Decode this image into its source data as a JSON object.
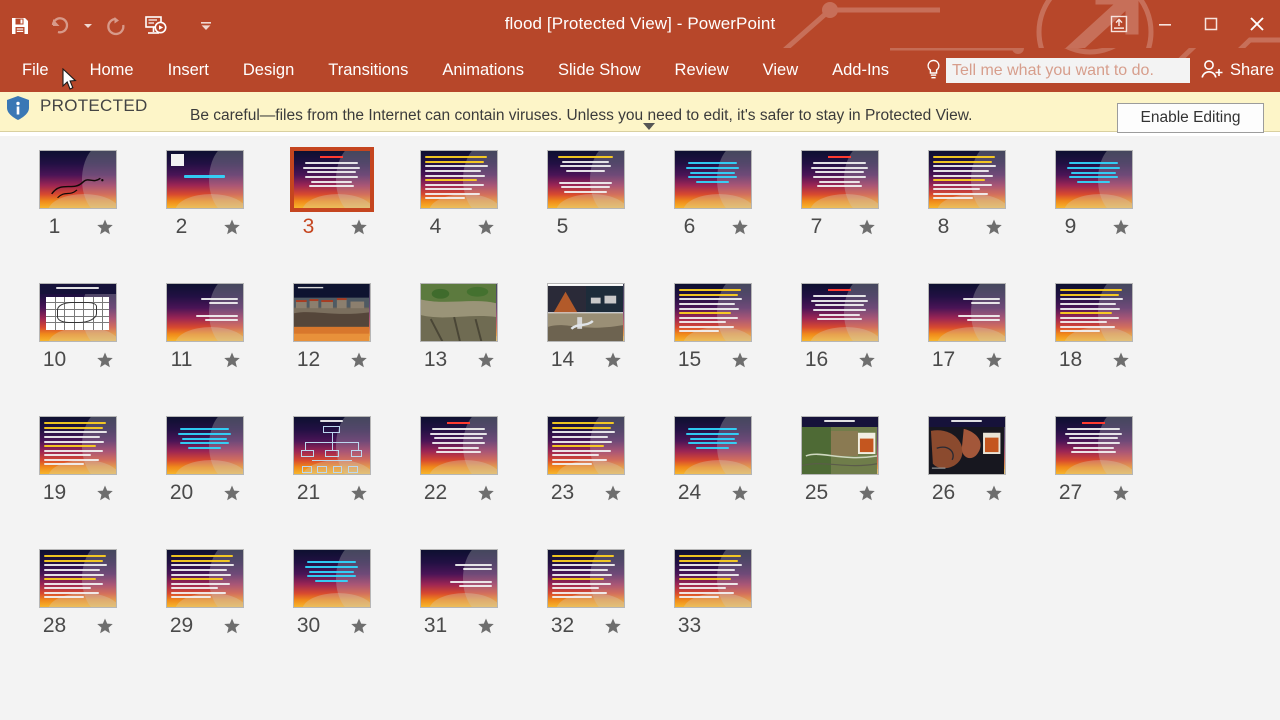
{
  "window": {
    "title": "flood [Protected View] - PowerPoint",
    "minimize_label": "Minimize",
    "restore_label": "Restore Down",
    "close_label": "Close",
    "ribbon_display_label": "Ribbon Display Options"
  },
  "quick_access": [
    {
      "name": "save",
      "label": "Save",
      "icon": "save-icon",
      "enabled": true
    },
    {
      "name": "undo",
      "label": "Undo",
      "icon": "undo-icon",
      "enabled": false
    },
    {
      "name": "redo",
      "label": "Repeat",
      "icon": "redo-icon",
      "enabled": false
    },
    {
      "name": "start-from-beginning",
      "label": "Start From Beginning",
      "icon": "slideshow-icon",
      "enabled": true
    },
    {
      "name": "customize",
      "label": "Customize Quick Access Toolbar",
      "icon": "chevron-down-icon",
      "enabled": true
    }
  ],
  "ribbon": {
    "tabs": [
      {
        "label": "File"
      },
      {
        "label": "Home"
      },
      {
        "label": "Insert"
      },
      {
        "label": "Design"
      },
      {
        "label": "Transitions"
      },
      {
        "label": "Animations"
      },
      {
        "label": "Slide Show"
      },
      {
        "label": "Review"
      },
      {
        "label": "View"
      },
      {
        "label": "Add-Ins"
      }
    ],
    "tellme": {
      "placeholder": "Tell me what you want to do.",
      "icon": "lightbulb-icon"
    },
    "share": {
      "label": "Share",
      "icon": "share-person-icon"
    }
  },
  "protected_view": {
    "badge": "PROTECTED",
    "icon": "shield-icon",
    "message": "Be careful—files from the Internet can contain viruses. Unless you need to edit, it's safer to stay in Protected View.",
    "button": "Enable Editing",
    "collapse_icon": "chevron-down-icon"
  },
  "colors": {
    "title_bar": "#b7472a",
    "ribbon": "#b7472a",
    "protected_bar": "#fdf5c8",
    "selection": "#c5451f",
    "sorter_bg": "#f3f3f3"
  },
  "slide_sorter": {
    "selected_slide": 3,
    "total_slides": 33,
    "slides": [
      {
        "number": "1",
        "starred": true,
        "kind": "calligraphy"
      },
      {
        "number": "2",
        "starred": true,
        "kind": "bismillah"
      },
      {
        "number": "3",
        "starred": true,
        "kind": "text-title"
      },
      {
        "number": "4",
        "starred": true,
        "kind": "text-dense"
      },
      {
        "number": "5",
        "starred": false,
        "kind": "text-two-block"
      },
      {
        "number": "6",
        "starred": true,
        "kind": "text-center"
      },
      {
        "number": "7",
        "starred": true,
        "kind": "text-title"
      },
      {
        "number": "8",
        "starred": true,
        "kind": "text-dense"
      },
      {
        "number": "9",
        "starred": true,
        "kind": "text-center"
      },
      {
        "number": "10",
        "starred": true,
        "kind": "map"
      },
      {
        "number": "11",
        "starred": true,
        "kind": "text-sparse"
      },
      {
        "number": "12",
        "starred": true,
        "kind": "photo-flood-town"
      },
      {
        "number": "13",
        "starred": true,
        "kind": "photo-landslide"
      },
      {
        "number": "14",
        "starred": true,
        "kind": "photo-collage"
      },
      {
        "number": "15",
        "starred": true,
        "kind": "text-dense"
      },
      {
        "number": "16",
        "starred": true,
        "kind": "text-title"
      },
      {
        "number": "17",
        "starred": true,
        "kind": "text-sparse"
      },
      {
        "number": "18",
        "starred": true,
        "kind": "text-dense"
      },
      {
        "number": "19",
        "starred": true,
        "kind": "text-dense"
      },
      {
        "number": "20",
        "starred": true,
        "kind": "text-center"
      },
      {
        "number": "21",
        "starred": true,
        "kind": "org-chart"
      },
      {
        "number": "22",
        "starred": true,
        "kind": "text-title"
      },
      {
        "number": "23",
        "starred": true,
        "kind": "text-dense"
      },
      {
        "number": "24",
        "starred": true,
        "kind": "text-center"
      },
      {
        "number": "25",
        "starred": true,
        "kind": "photo-satellite-before"
      },
      {
        "number": "26",
        "starred": true,
        "kind": "photo-satellite-after"
      },
      {
        "number": "27",
        "starred": true,
        "kind": "text-title"
      },
      {
        "number": "28",
        "starred": true,
        "kind": "text-dense"
      },
      {
        "number": "29",
        "starred": true,
        "kind": "text-dense"
      },
      {
        "number": "30",
        "starred": true,
        "kind": "text-center"
      },
      {
        "number": "31",
        "starred": true,
        "kind": "text-sparse"
      },
      {
        "number": "32",
        "starred": true,
        "kind": "text-dense"
      },
      {
        "number": "33",
        "starred": false,
        "kind": "text-dense"
      }
    ]
  }
}
